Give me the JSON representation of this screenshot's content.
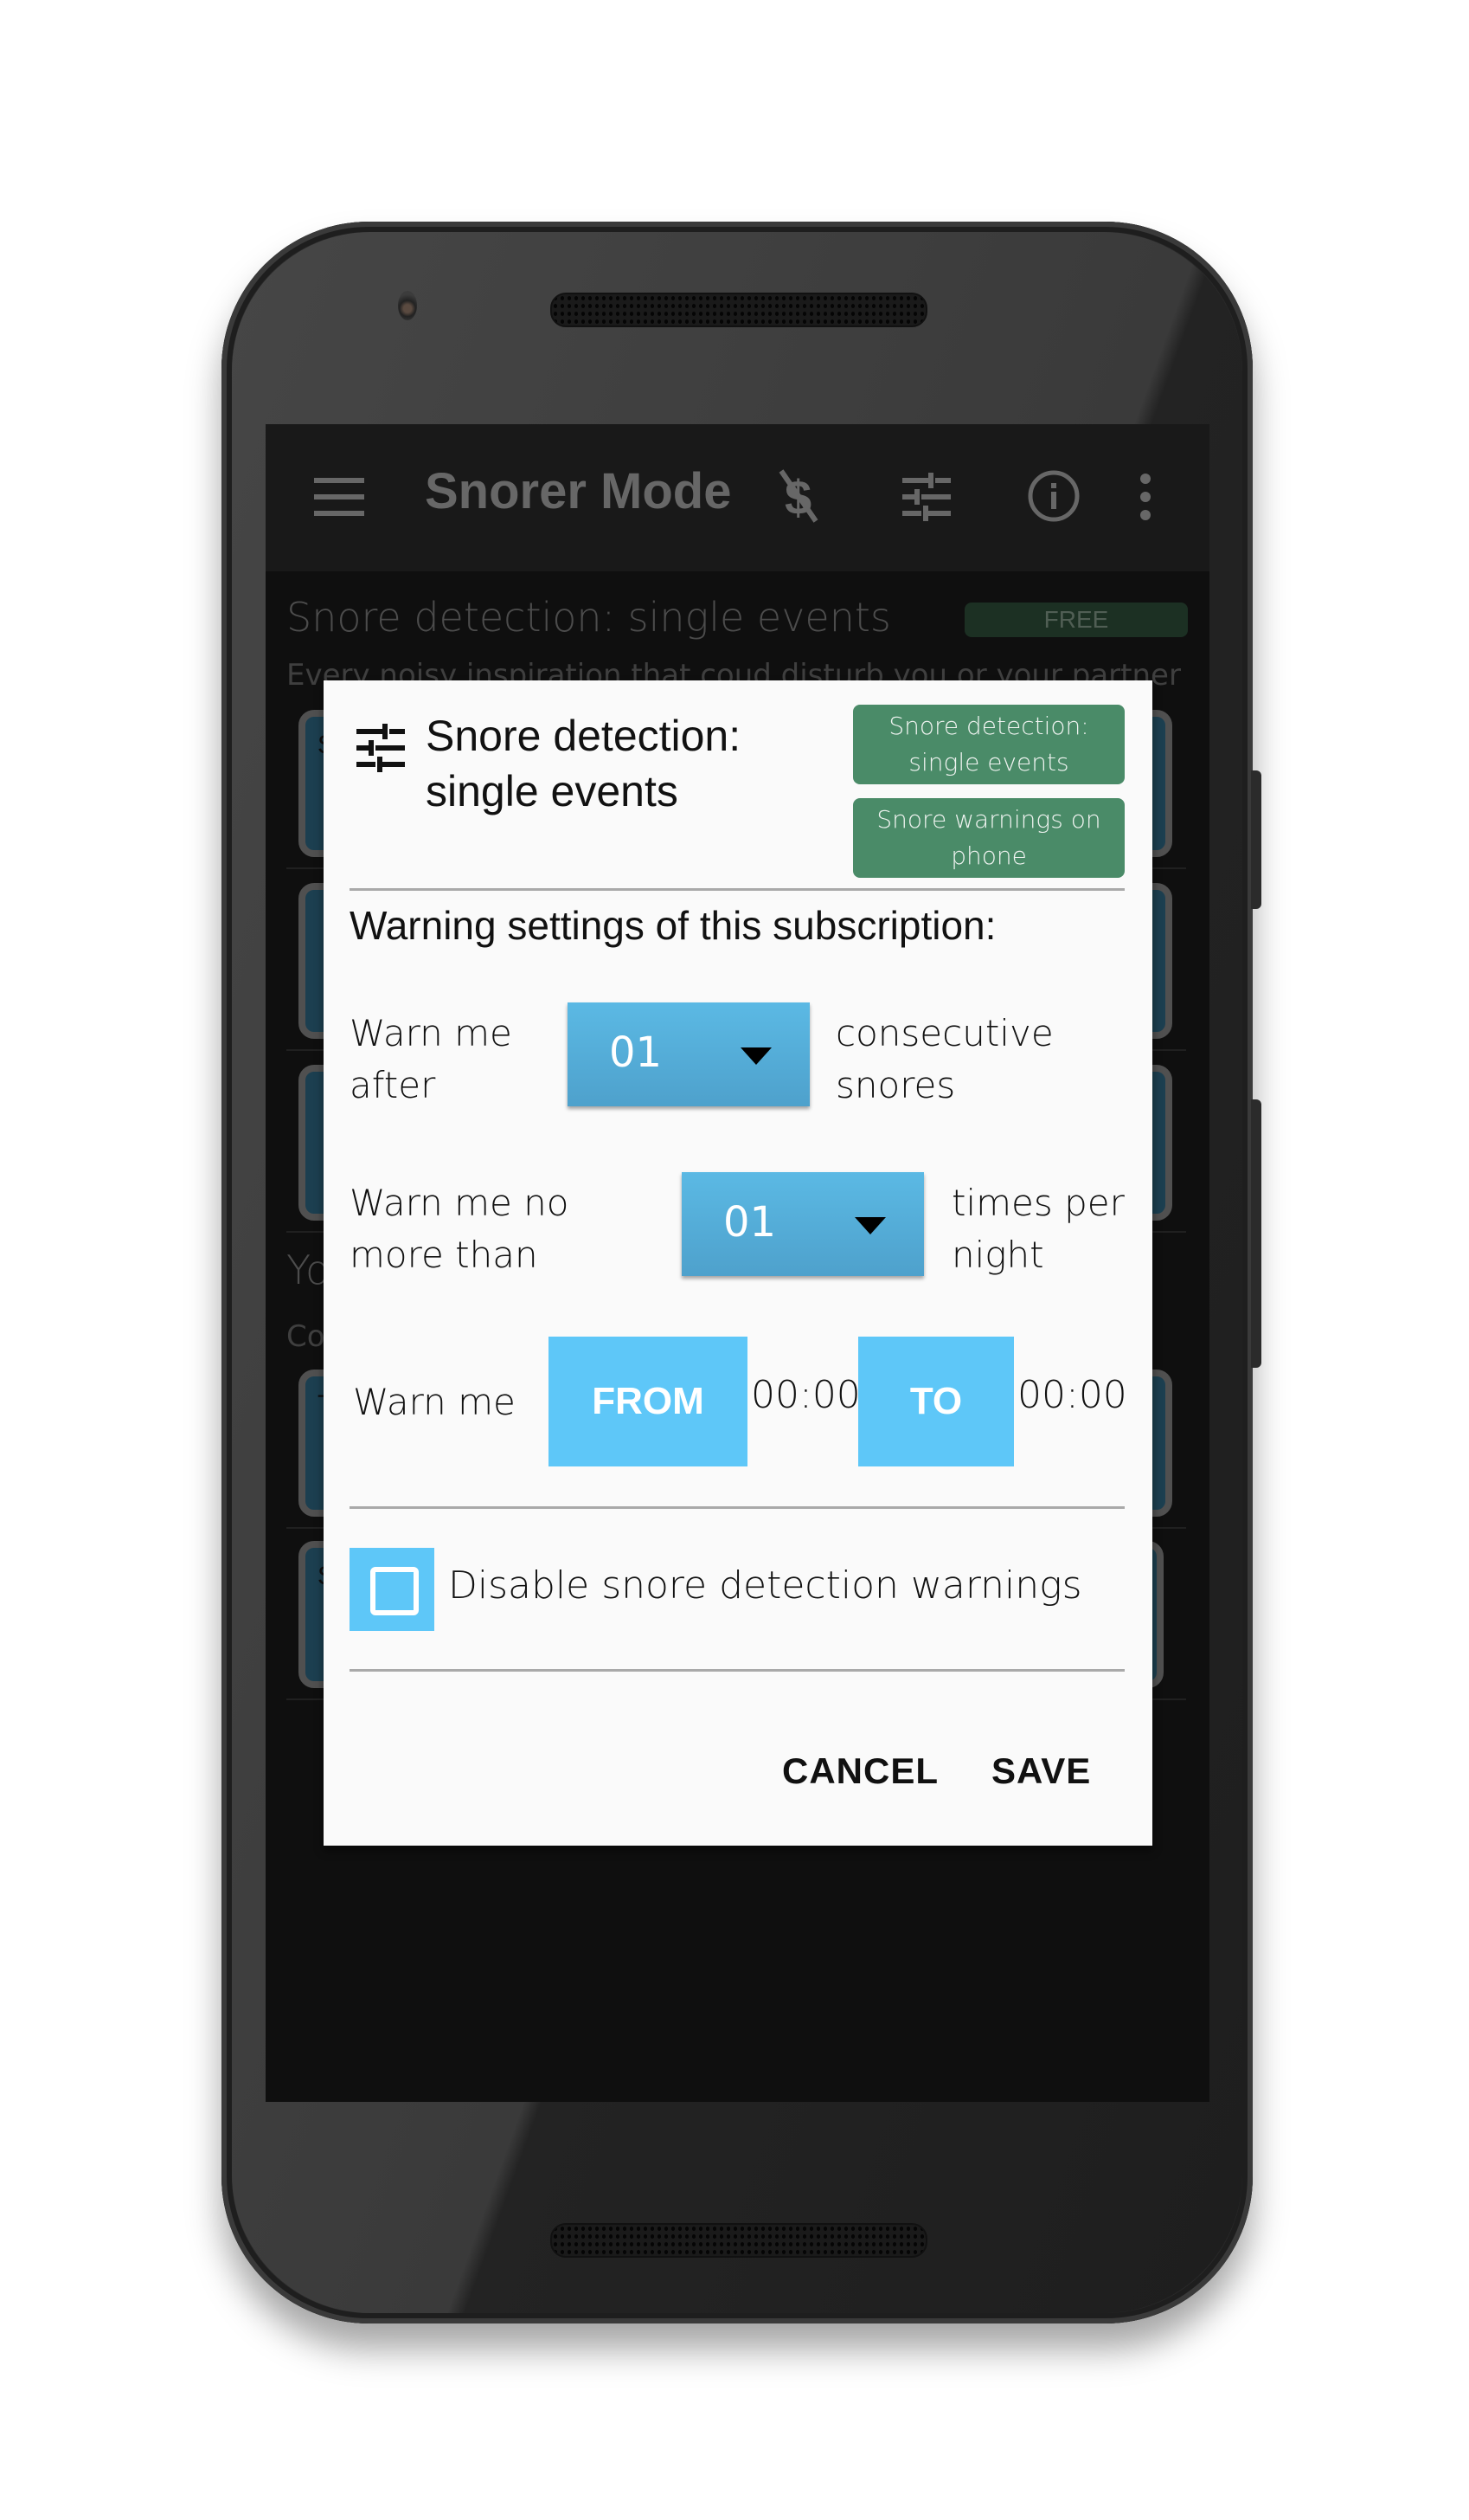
{
  "app": {
    "title": "Snorer Mode",
    "toolbar_icons": [
      "menu-icon",
      "no-money-icon",
      "sliders-icon",
      "info-icon",
      "more-vert-icon"
    ]
  },
  "background": {
    "section1": {
      "title": "Snore detection: single events",
      "subtitle": "Every noisy inspiration that coud disturb you or your partner",
      "badge": "FREE",
      "card_letters": [
        "S",
        "",
        ""
      ]
    },
    "section2": {
      "title": "Yo",
      "subtitle": "Co",
      "card_letters": [
        "T",
        "S"
      ]
    }
  },
  "dialog": {
    "title": "Snore detection: single events",
    "title_icon": "sliders-icon",
    "tags": [
      "Snore detection: single events",
      "Snore warnings on phone"
    ],
    "section_heading": "Warning settings of this subscription:",
    "row1": {
      "prefix": "Warn me after",
      "value": "01",
      "suffix": "consecutive snores"
    },
    "row2": {
      "prefix": "Warn me no more than",
      "value": "01",
      "suffix": "times per night"
    },
    "row3": {
      "prefix": "Warn me",
      "from_label": "FROM",
      "from_value": "00:00",
      "to_label": "TO",
      "to_value": "00:00"
    },
    "checkbox": {
      "label": "Disable snore detection warnings",
      "checked": false
    },
    "buttons": {
      "cancel": "CANCEL",
      "save": "SAVE"
    }
  },
  "colors": {
    "accent_blue": "#5ec7f8",
    "spinner_blue": "#55addb",
    "tag_green": "#4a8b68",
    "dialog_bg": "#fafafa"
  }
}
